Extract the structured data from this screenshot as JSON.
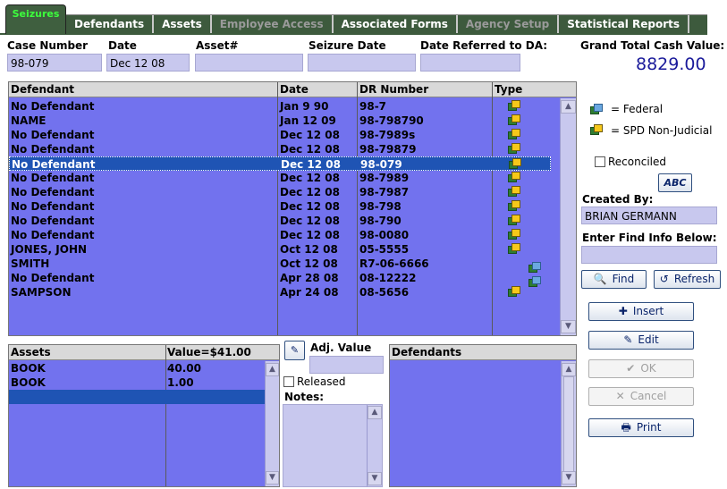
{
  "tabs": {
    "active": "Seizures",
    "items": [
      {
        "label": "Defendants",
        "disabled": false
      },
      {
        "label": "Assets",
        "disabled": false
      },
      {
        "label": "Employee Access",
        "disabled": true
      },
      {
        "label": "Associated Forms",
        "disabled": false
      },
      {
        "label": "Agency Setup",
        "disabled": true
      },
      {
        "label": "Statistical Reports",
        "disabled": false
      }
    ]
  },
  "header": {
    "case_number_label": "Case Number",
    "case_number": "98-079",
    "date_label": "Date",
    "date": "Dec 12 08",
    "asset_label": "Asset#",
    "asset": "",
    "seizure_date_label": "Seizure Date",
    "seizure_date": "",
    "date_referred_label": "Date Referred to DA:",
    "date_referred": "",
    "grand_total_label": "Grand Total Cash Value:",
    "grand_total": "8829.00"
  },
  "seizures_grid": {
    "columns": [
      "Defendant",
      "Date",
      "DR Number",
      "Type"
    ],
    "rows": [
      {
        "defendant": "No Defendant",
        "date": "Jan 9 90",
        "dr": "98-7",
        "type": "spd"
      },
      {
        "defendant": "NAME",
        "date": "Jan 12 09",
        "dr": "98-798790",
        "type": "spd"
      },
      {
        "defendant": "No Defendant",
        "date": "Dec 12 08",
        "dr": "98-7989s",
        "type": "spd"
      },
      {
        "defendant": "No Defendant",
        "date": "Dec 12 08",
        "dr": "98-79879",
        "type": "spd"
      },
      {
        "defendant": "No Defendant",
        "date": "Dec 12 08",
        "dr": "98-079",
        "type": "spd",
        "selected": true
      },
      {
        "defendant": "No Defendant",
        "date": "Dec 12 08",
        "dr": "98-7989",
        "type": "spd"
      },
      {
        "defendant": "No Defendant",
        "date": "Dec 12 08",
        "dr": "98-7987",
        "type": "spd"
      },
      {
        "defendant": "No Defendant",
        "date": "Dec 12 08",
        "dr": "98-798",
        "type": "spd"
      },
      {
        "defendant": "No Defendant",
        "date": "Dec 12 08",
        "dr": "98-790",
        "type": "spd"
      },
      {
        "defendant": "No Defendant",
        "date": "Dec 12 08",
        "dr": "98-0080",
        "type": "spd"
      },
      {
        "defendant": "JONES, JOHN",
        "date": "Oct 12 08",
        "dr": "05-5555",
        "type": "spd"
      },
      {
        "defendant": "SMITH",
        "date": "Oct 12 08",
        "dr": "R7-06-6666",
        "type": "federal"
      },
      {
        "defendant": "No Defendant",
        "date": "Apr 28 08",
        "dr": "08-12222",
        "type": "federal"
      },
      {
        "defendant": "SAMPSON",
        "date": "Apr 24 08",
        "dr": "08-5656",
        "type": "spd"
      }
    ]
  },
  "legend": {
    "federal": "= Federal",
    "spd": "= SPD Non-Judicial",
    "federal_icon": "money-federal-icon",
    "spd_icon": "money-spd-icon"
  },
  "side": {
    "reconciled_label": "Reconciled",
    "abc_label": "ABC",
    "created_by_label": "Created By:",
    "created_by": "BRIAN GERMANN",
    "find_info_label": "Enter Find Info Below:",
    "find_value": "",
    "find_button": "Find",
    "refresh_button": "Refresh",
    "insert_button": "Insert",
    "edit_button": "Edit",
    "ok_button": "OK",
    "cancel_button": "Cancel",
    "print_button": "Print"
  },
  "assets_grid": {
    "col_assets": "Assets",
    "col_value": "Value=$41.00",
    "rows": [
      {
        "name": "BOOK",
        "value": "40.00"
      },
      {
        "name": "BOOK",
        "value": "1.00"
      }
    ]
  },
  "asset_detail": {
    "adj_value_label": "Adj. Value",
    "adj_value": "",
    "released_label": "Released",
    "notes_label": "Notes:"
  },
  "defendants_grid": {
    "header": "Defendants"
  },
  "colors": {
    "grid_bg": "#7272ee",
    "field_bg": "#c8c8ee",
    "tab_bg": "#3d5a3d",
    "total_color": "#1a1a9a"
  }
}
